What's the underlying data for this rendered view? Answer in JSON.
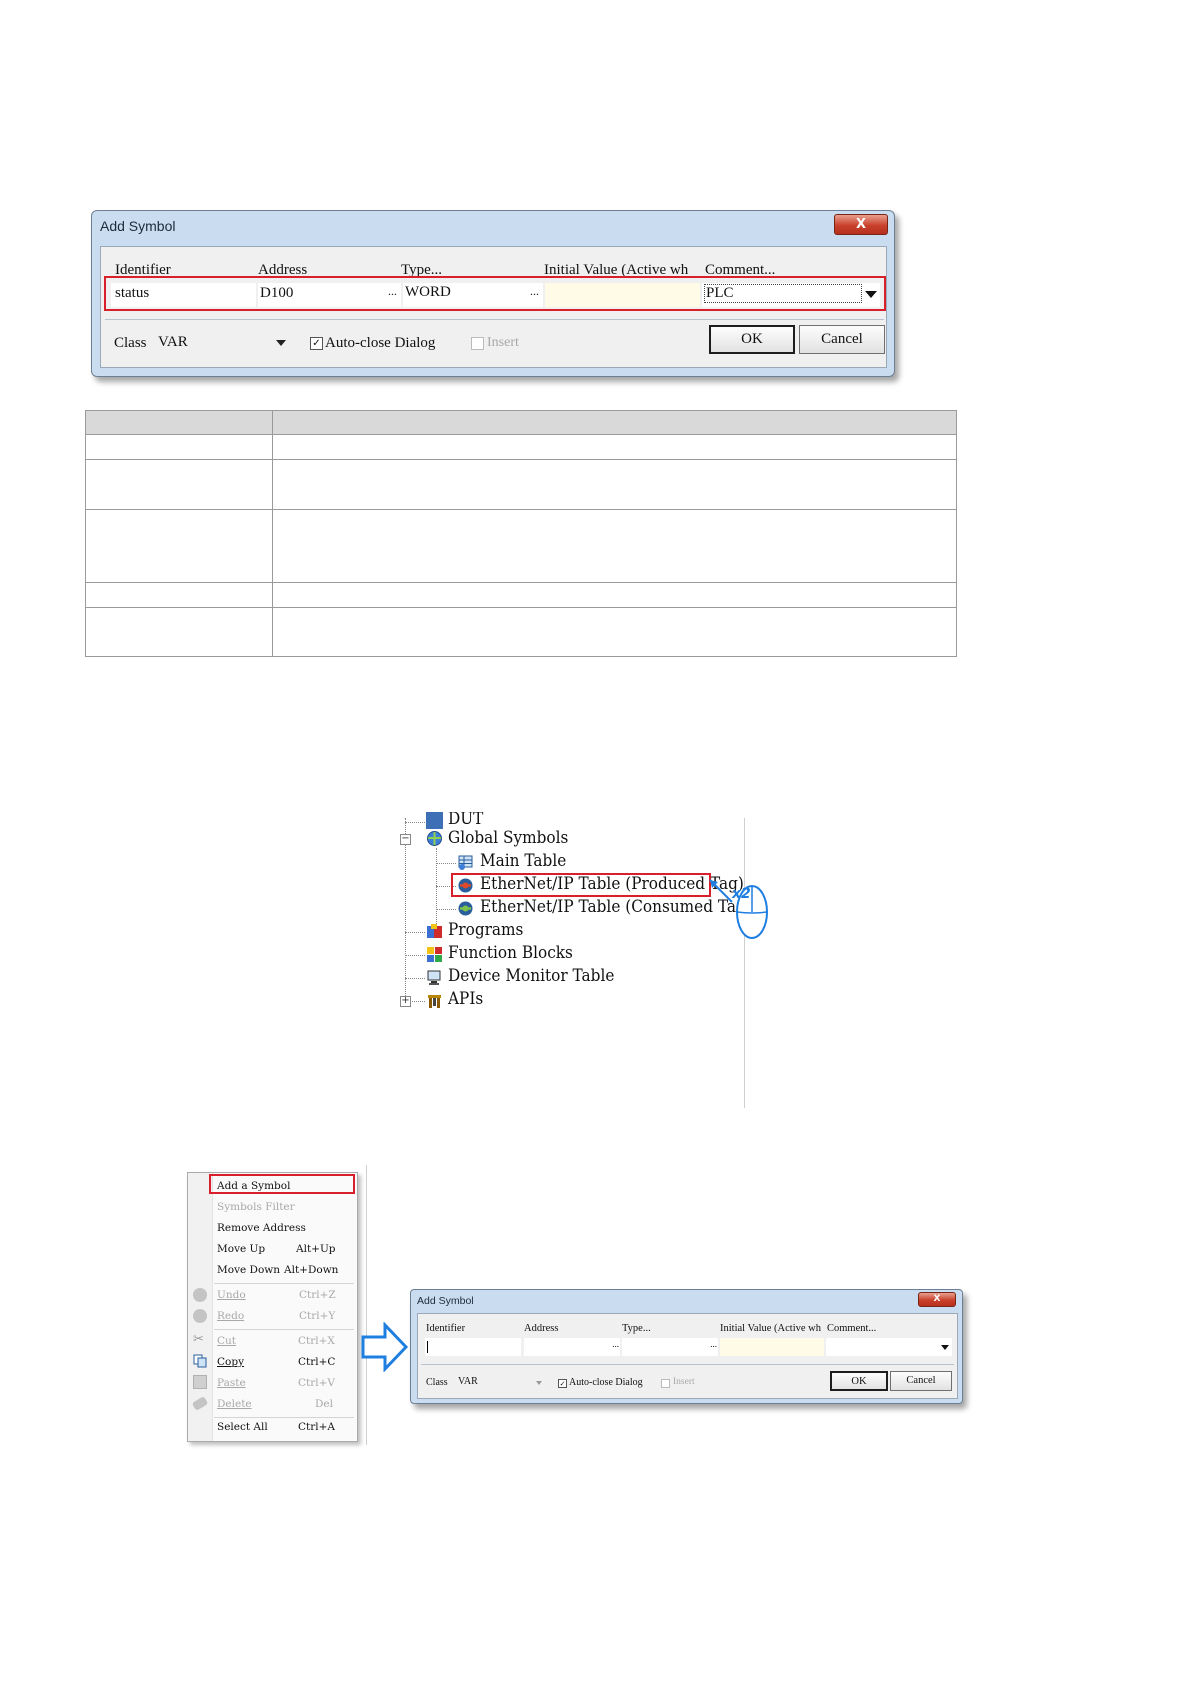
{
  "dialog1": {
    "title": "Add Symbol",
    "close_label": "X",
    "columns": {
      "identifier": "Identifier",
      "address": "Address",
      "type": "Type...",
      "initial_value": "Initial Value (Active wh",
      "comment": "Comment..."
    },
    "row": {
      "identifier": "status",
      "address": "D100",
      "address_browse": "...",
      "type": "WORD",
      "type_browse": "...",
      "initial_value": "",
      "comment": "PLC"
    },
    "class_label": "Class",
    "class_value": "VAR",
    "auto_close_label": "Auto-close Dialog",
    "auto_close_checked": true,
    "insert_label": "Insert",
    "insert_checked": false,
    "ok_label": "OK",
    "cancel_label": "Cancel"
  },
  "tree": {
    "nodes": [
      {
        "label": "DUT"
      },
      {
        "label": "Global Symbols"
      },
      {
        "label": "Main Table"
      },
      {
        "label": "EtherNet/IP Table (Produced Tag)"
      },
      {
        "label": "EtherNet/IP Table (Consumed Tag)"
      },
      {
        "label": "Programs"
      },
      {
        "label": "Function Blocks"
      },
      {
        "label": "Device Monitor Table"
      },
      {
        "label": "APIs"
      }
    ],
    "mouse_badge": "x2",
    "expand_minus": "−",
    "expand_plus": "+"
  },
  "context_menu": {
    "items": [
      {
        "label": "Add a Symbol",
        "shortcut": "",
        "enabled": true,
        "icon": ""
      },
      {
        "label": "Symbols Filter",
        "shortcut": "",
        "enabled": false,
        "icon": ""
      },
      {
        "label": "Remove Address",
        "shortcut": "",
        "enabled": true,
        "icon": ""
      },
      {
        "label": "Move Up",
        "shortcut": "Alt+Up",
        "enabled": true,
        "icon": ""
      },
      {
        "label": "Move Down",
        "shortcut": "Alt+Down",
        "enabled": true,
        "icon": ""
      },
      {
        "label": "Undo",
        "shortcut": "Ctrl+Z",
        "enabled": false,
        "icon": "undo-icon"
      },
      {
        "label": "Redo",
        "shortcut": "Ctrl+Y",
        "enabled": false,
        "icon": "redo-icon"
      },
      {
        "label": "Cut",
        "shortcut": "Ctrl+X",
        "enabled": false,
        "icon": "scissors-icon"
      },
      {
        "label": "Copy",
        "shortcut": "Ctrl+C",
        "enabled": true,
        "icon": "copy-icon"
      },
      {
        "label": "Paste",
        "shortcut": "Ctrl+V",
        "enabled": false,
        "icon": "paste-icon"
      },
      {
        "label": "Delete",
        "shortcut": "Del",
        "enabled": false,
        "icon": "eraser-icon"
      },
      {
        "label": "Select All",
        "shortcut": "Ctrl+A",
        "enabled": true,
        "icon": ""
      }
    ]
  },
  "dialog2": {
    "title": "Add Symbol",
    "close_label": "X",
    "columns": {
      "identifier": "Identifier",
      "address": "Address",
      "type": "Type...",
      "initial_value": "Initial Value (Active wh",
      "comment": "Comment..."
    },
    "address_browse": "...",
    "type_browse": "...",
    "class_label": "Class",
    "class_value": "VAR",
    "auto_close_label": "Auto-close Dialog",
    "insert_label": "Insert",
    "ok_label": "OK",
    "cancel_label": "Cancel"
  },
  "colors": {
    "highlight": "#d8202a",
    "dialog_frame": "#c9dcf0",
    "arrow": "#1e7fe0"
  }
}
